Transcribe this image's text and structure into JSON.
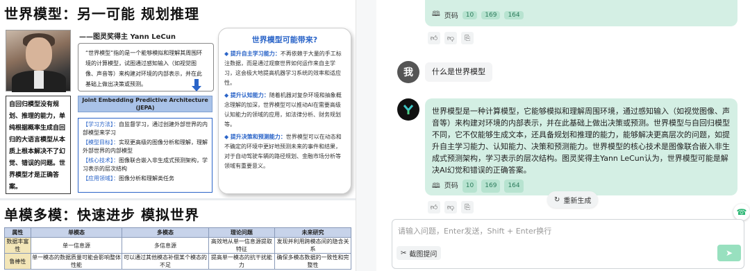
{
  "slide": {
    "title1": "世界模型：另一可能 规划推理",
    "byline": "——图灵奖得主 Yann LeCun",
    "quote": "“世界模型”指的是一个能够模拟和理解其周围环境的计算模型，试图通过感知输入（如视觉图像、声音等）来构建对环境的内部表示，并在此基础上做出决策或预测。",
    "jepa_title": "Joint Embedding Predictive Architecture (JEPA)",
    "jepa_rows": [
      {
        "tag": "【学习方法】：",
        "text": "自监督学习，通过创建外部世界的内部模型来学习"
      },
      {
        "tag": "【模型目标】：",
        "text": "实现更高级的图像分析和理解，理解外部世界的内部模型"
      },
      {
        "tag": "【核心技术】：",
        "text": "图像联合嵌入非生成式预测架构，学习表示的层次结构"
      },
      {
        "tag": "【应用领域】：",
        "text": "图像分析和理解类任务"
      }
    ],
    "left_text": "自回归模型没有规划、推理的能力，单纯根据概率生成自回归的大语言模型从本质上根本解决不了幻觉、错误的问题。世界模型才是正确答案。",
    "panel_title": "世界模型可能带来?",
    "panel_items": [
      {
        "head": "提升自主学习能力：",
        "text": "不再依赖于大量的手工标注数据，而是通过观察世界如何运作来自主学习，这会极大地提高机器学习系统的效率和适应性。"
      },
      {
        "head": "提升认知能力：",
        "text": "随着机器对复杂环境和抽象概念理解的加深，世界模型可以推动AI在需要高级认知能力的领域的应用，如法律分析、财务规划等。"
      },
      {
        "head": "提升决策和预测能力：",
        "text": "世界模型可以在动态和不确定的环境中更好地预测未来的事件和结果，对于自动驾驶车辆的路径规划、金融市场分析等领域有重要意义。"
      }
    ],
    "title2": "单模多模：快速进步 模拟世界",
    "table": {
      "headers": [
        "属性",
        "单模态",
        "多模态",
        "理论问题",
        "未来研究"
      ],
      "rows": [
        [
          "数据丰富性",
          "单一信息源",
          "多信息源",
          "高效地从单一信息源提取特征",
          "发现并利用跨模态间的隐含关系"
        ],
        [
          "鲁棒性",
          "单一模态的数据质量可能会影响整体性能",
          "可以通过其他模态补偿某个模态的不足",
          "提高单一模态的抗干扰能力",
          "确保多模态数据的一致性和完整性"
        ]
      ]
    }
  },
  "chat": {
    "ref_label": "页码",
    "top_refs": [
      "10",
      "169",
      "164"
    ],
    "user_avatar": "我",
    "user_msg": "什么是世界模型",
    "bot_msg": "世界模型是一种计算模型，它能够模拟和理解周围环境，通过感知输入（如视觉图像、声音等）来构建对环境的内部表示，并在此基础上做出决策或预测。世界模型与自回归模型不同，它不仅能够生成文本，还具备规划和推理的能力，能够解决更高层次的问题，如提升自主学习能力、认知能力、决策和预测能力。世界模型的核心技术是图像联合嵌入非生成式预测架构，学习表示的层次结构。图灵奖得主Yann LeCun认为，世界模型可能是解决AI幻觉和错误的正确答案。",
    "bot_refs": [
      "10",
      "169",
      "164"
    ],
    "regen_label": "重新生成",
    "input_placeholder": "请输入问题，Enter发送，Shift + Enter换行",
    "screenshot_label": "截图提问"
  }
}
